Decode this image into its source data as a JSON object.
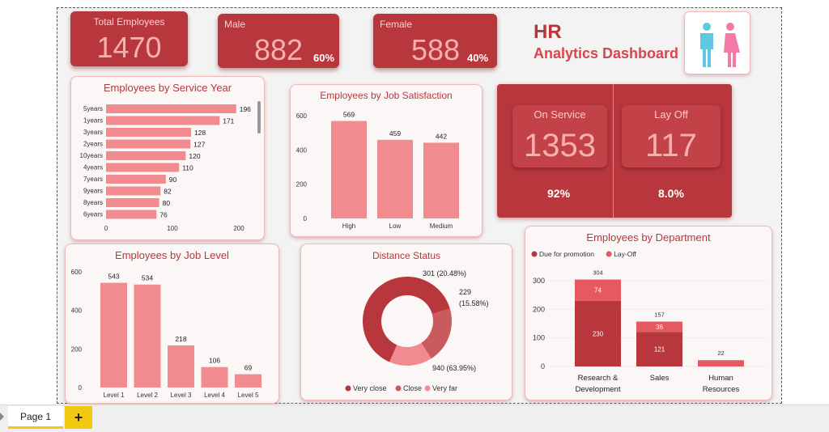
{
  "kpis": {
    "total": {
      "label": "Total Employees",
      "value": "1470"
    },
    "male": {
      "label": "Male",
      "value": "882",
      "pct": "60%"
    },
    "female": {
      "label": "Female",
      "value": "588",
      "pct": "40%"
    }
  },
  "title": {
    "line1": "HR",
    "line2": "Analytics Dashboard"
  },
  "service_panel": {
    "on_label": "On Service",
    "on_value": "1353",
    "on_pct": "92%",
    "off_label": "Lay Off",
    "off_value": "117",
    "off_pct": "8.0%"
  },
  "colors": {
    "accent": "#b7373d",
    "bar_pink": "#f28b8f",
    "light_red": "#e55a5f",
    "tab_yellow": "#f2c811"
  },
  "tabs": {
    "page1": "Page 1",
    "add": "+"
  },
  "chart_data": [
    {
      "id": "service",
      "type": "bar",
      "orientation": "horizontal",
      "title": "Employees by Service Year",
      "categories": [
        "5years",
        "1years",
        "3years",
        "2years",
        "10years",
        "4years",
        "7years",
        "9years",
        "8years",
        "6years"
      ],
      "values": [
        196,
        171,
        128,
        127,
        120,
        110,
        90,
        82,
        80,
        76
      ],
      "xticks": [
        "0",
        "100",
        "200"
      ],
      "xlim": [
        0,
        200
      ]
    },
    {
      "id": "satisfaction",
      "type": "bar",
      "title": "Employees by Job Satisfaction",
      "categories": [
        "High",
        "Low",
        "Medium"
      ],
      "values": [
        569,
        459,
        442
      ],
      "yticks": [
        "0",
        "200",
        "400",
        "600"
      ],
      "ylim": [
        0,
        600
      ]
    },
    {
      "id": "joblevel",
      "type": "bar",
      "title": "Employees by Job Level",
      "categories": [
        "Level 1",
        "Level 2",
        "Level 3",
        "Level 4",
        "Level 5"
      ],
      "values": [
        543,
        534,
        218,
        106,
        69
      ],
      "yticks": [
        "0",
        "200",
        "400",
        "600"
      ],
      "ylim": [
        0,
        600
      ]
    },
    {
      "id": "distance",
      "type": "pie",
      "title": "Distance Status",
      "slices": [
        {
          "name": "Very close",
          "value": 940,
          "label": "940 (63.95%)",
          "color": "#b7373d"
        },
        {
          "name": "Close",
          "value": 301,
          "label": "301 (20.48%)",
          "color": "#c95a5e"
        },
        {
          "name": "Very far",
          "value": 229,
          "label_line1": "229",
          "label_line2": "(15.58%)",
          "color": "#f28b8f"
        }
      ]
    },
    {
      "id": "department",
      "type": "bar",
      "stacked": true,
      "title": "Employees by Department",
      "categories": [
        "Research & Development",
        "Sales",
        "Human Resources"
      ],
      "category_lines": [
        [
          "Research &",
          "Development"
        ],
        [
          "Sales"
        ],
        [
          "Human",
          "Resources"
        ]
      ],
      "series": [
        {
          "name": "Due for promotion",
          "values": [
            230,
            121,
            0
          ],
          "color": "#b7373d"
        },
        {
          "name": "Lay-Off",
          "values": [
            74,
            36,
            22
          ],
          "color": "#e55a5f"
        }
      ],
      "inner_labels": [
        [
          "230",
          "74"
        ],
        [
          "121",
          "36"
        ],
        [
          "",
          ""
        ]
      ],
      "totals": [
        "304",
        "157",
        "22"
      ],
      "yticks": [
        "0",
        "100",
        "200",
        "300"
      ],
      "ylim": [
        0,
        300
      ]
    }
  ]
}
